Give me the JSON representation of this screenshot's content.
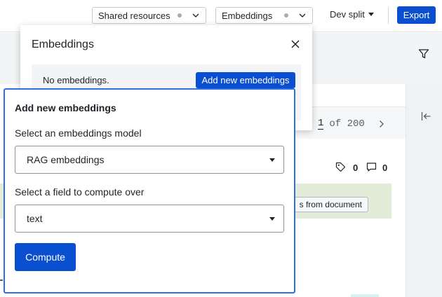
{
  "topbar": {
    "shared_resources_label": "Shared resources",
    "embeddings_label": "Embeddings",
    "dev_split_label": "Dev split",
    "export_label": "Export"
  },
  "background": {
    "pager": {
      "current": "1",
      "of_label": "of 200"
    },
    "tag_count": "0",
    "comment_count": "0",
    "doc_chip_label": "s from document"
  },
  "embeddings_popover": {
    "title": "Embeddings",
    "empty_text": "No embeddings.",
    "add_button_label": "Add new embeddings"
  },
  "add_panel": {
    "title": "Add new embeddings",
    "model_label": "Select an embeddings model",
    "model_value": "RAG embeddings",
    "field_label": "Select a field to compute over",
    "field_value": "text",
    "compute_label": "Compute"
  },
  "colors": {
    "accent": "#0b4fd1",
    "panel_border": "#2f6fe0",
    "green_band": "#e2ecd8"
  },
  "icons": [
    "chevron-down-icon",
    "filter-icon",
    "collapse-left-icon",
    "chevron-right-icon",
    "tag-icon",
    "comment-icon",
    "close-icon",
    "caret-down-icon"
  ]
}
